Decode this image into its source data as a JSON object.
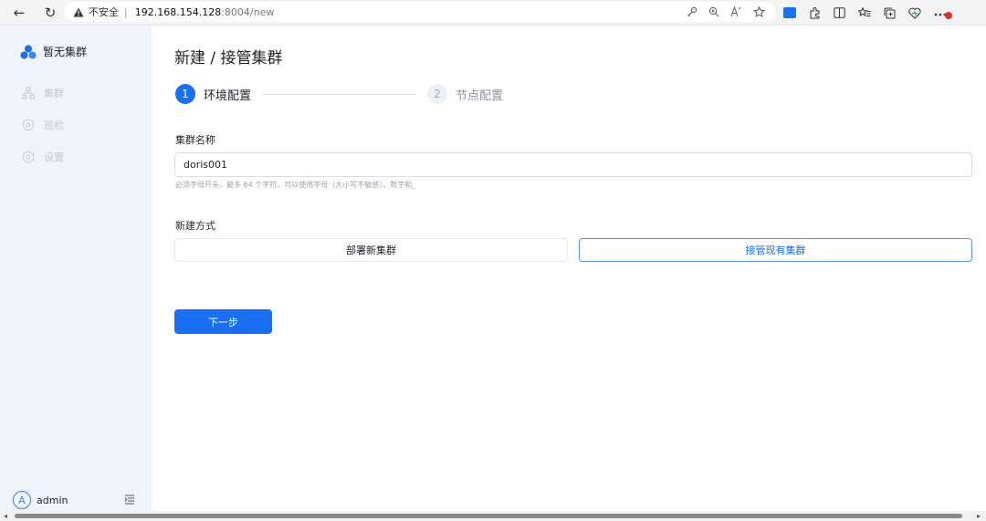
{
  "browser": {
    "back_icon": "←",
    "refresh_icon": "↻",
    "security_icon": "warning-icon",
    "security_label": "不安全",
    "separator": "|",
    "url_host": "192.168.154.128",
    "url_path": ":8004/new"
  },
  "sidebar": {
    "brand": "暂无集群",
    "items": [
      {
        "label": "集群",
        "icon": "cluster-icon"
      },
      {
        "label": "巡检",
        "icon": "shield-icon"
      },
      {
        "label": "设置",
        "icon": "gear-icon"
      }
    ],
    "user": {
      "avatar_letter": "A",
      "name": "admin"
    }
  },
  "main": {
    "title": "新建 / 接管集群",
    "steps": [
      {
        "number": "1",
        "label": "环境配置"
      },
      {
        "number": "2",
        "label": "节点配置"
      }
    ],
    "cluster_name": {
      "label": "集群名称",
      "value": "doris001",
      "hint": "必须字母开头，最多 64 个字符，可以使用字母（大小写不敏感）、数字和_"
    },
    "create_mode": {
      "label": "新建方式",
      "options": [
        "部署新集群",
        "接管现有集群"
      ],
      "selected": "接管现有集群"
    },
    "next_button": "下一步"
  },
  "colors": {
    "primary": "#1a6ef4",
    "sidebar_bg": "#eef3fc",
    "muted_text": "#9ba2ab"
  }
}
